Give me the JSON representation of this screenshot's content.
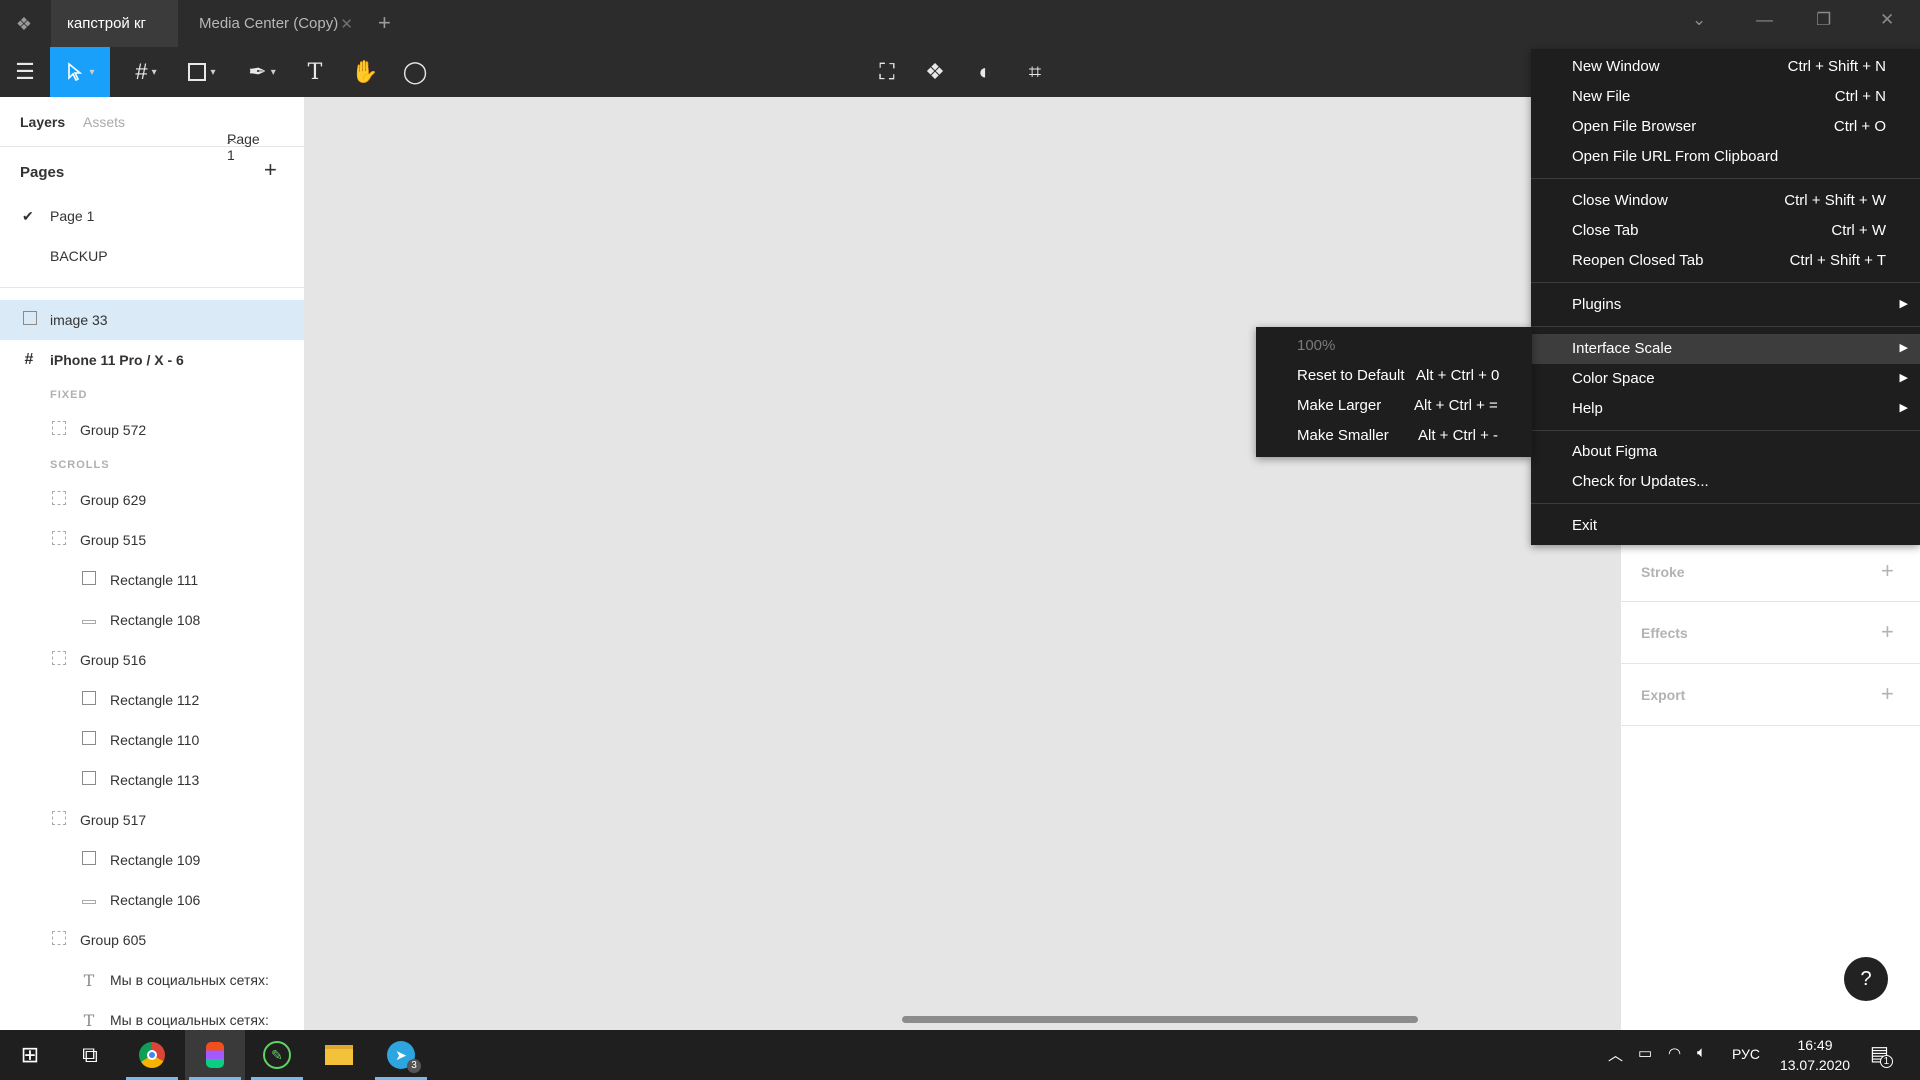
{
  "titlebar": {
    "tabs": [
      {
        "label": "капстрой кг"
      },
      {
        "label": "Media Center (Copy)"
      }
    ]
  },
  "left_panel": {
    "tabs": [
      "Layers",
      "Assets"
    ],
    "page_selector": "Page 1",
    "pages_title": "Pages",
    "pages": [
      "Page 1",
      "BACKUP"
    ],
    "layers": [
      {
        "label": "image 33"
      },
      {
        "label": "iPhone 11 Pro / X - 6"
      },
      {
        "label": "FIXED"
      },
      {
        "label": "Group 572"
      },
      {
        "label": "SCROLLS"
      },
      {
        "label": "Group 629"
      },
      {
        "label": "Group 515"
      },
      {
        "label": "Rectangle 111"
      },
      {
        "label": "Rectangle 108"
      },
      {
        "label": "Group 516"
      },
      {
        "label": "Rectangle 112"
      },
      {
        "label": "Rectangle 110"
      },
      {
        "label": "Rectangle 113"
      },
      {
        "label": "Group 517"
      },
      {
        "label": "Rectangle 109"
      },
      {
        "label": "Rectangle 106"
      },
      {
        "label": "Group 605"
      },
      {
        "label": "Мы в социальных сетях:"
      },
      {
        "label": "Мы в социальных сетях:"
      }
    ]
  },
  "right_panel": {
    "sections": [
      "Stroke",
      "Effects",
      "Export"
    ],
    "help_label": "?"
  },
  "main_menu": {
    "items": [
      {
        "label": "New Window",
        "shortcut": "Ctrl + Shift + N"
      },
      {
        "label": "New File",
        "shortcut": "Ctrl + N"
      },
      {
        "label": "Open File Browser",
        "shortcut": "Ctrl + O"
      },
      {
        "label": "Open File URL From Clipboard",
        "shortcut": ""
      },
      {
        "label": "Close Window",
        "shortcut": "Ctrl + Shift + W"
      },
      {
        "label": "Close Tab",
        "shortcut": "Ctrl + W"
      },
      {
        "label": "Reopen Closed Tab",
        "shortcut": "Ctrl + Shift + T"
      },
      {
        "label": "Plugins",
        "shortcut": ""
      },
      {
        "label": "Interface Scale",
        "shortcut": ""
      },
      {
        "label": "Color Space",
        "shortcut": ""
      },
      {
        "label": "Help",
        "shortcut": ""
      },
      {
        "label": "About Figma",
        "shortcut": ""
      },
      {
        "label": "Check for Updates...",
        "shortcut": ""
      },
      {
        "label": "Exit",
        "shortcut": ""
      }
    ]
  },
  "submenu": {
    "items": [
      {
        "label": "100%",
        "shortcut": ""
      },
      {
        "label": "Reset to Default",
        "shortcut": "Alt + Ctrl + 0"
      },
      {
        "label": "Make Larger",
        "shortcut": "Alt + Ctrl + ="
      },
      {
        "label": "Make Smaller",
        "shortcut": "Alt + Ctrl + -"
      }
    ]
  },
  "taskbar": {
    "tray_lang": "РУС",
    "time": "16:49",
    "date": "13.07.2020",
    "telegram_badge": "3",
    "notif_badge": "1"
  },
  "colors": {
    "accent": "#18a0fb",
    "selected_row": "#daebf7",
    "dark_ui": "#2c2c2c",
    "menu_bg": "#1e1e1e"
  }
}
